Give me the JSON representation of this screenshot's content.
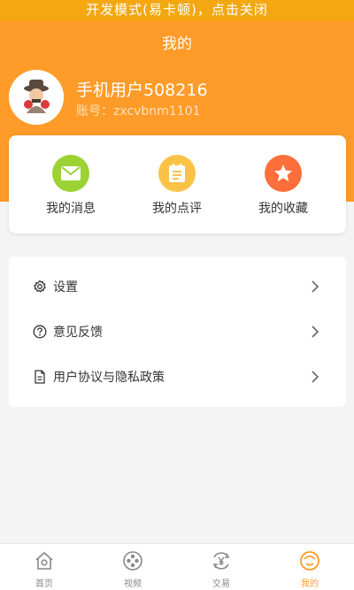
{
  "dev_banner": "开发模式(易卡顿)，点击关闭",
  "header": {
    "title": "我的"
  },
  "profile": {
    "username": "手机用户508216",
    "account": "账号：zxcvbnm1101"
  },
  "quick_actions": [
    {
      "label": "我的消息",
      "icon": "envelope-icon",
      "color": "#9bd234"
    },
    {
      "label": "我的点评",
      "icon": "notepad-icon",
      "color": "#fbc248"
    },
    {
      "label": "我的收藏",
      "icon": "star-icon",
      "color": "#ff6f3c"
    }
  ],
  "menu": [
    {
      "label": "设置",
      "icon": "gear-icon"
    },
    {
      "label": "意见反馈",
      "icon": "question-icon"
    },
    {
      "label": "用户协议与隐私政策",
      "icon": "document-icon"
    }
  ],
  "tabs": [
    {
      "label": "首页",
      "icon": "home-icon"
    },
    {
      "label": "视频",
      "icon": "film-reel-icon"
    },
    {
      "label": "交易",
      "icon": "yen-exchange-icon"
    },
    {
      "label": "我的",
      "icon": "profile-face-icon",
      "active": true
    }
  ],
  "colors": {
    "accent": "#ff9b28",
    "banner": "#f3a812"
  }
}
